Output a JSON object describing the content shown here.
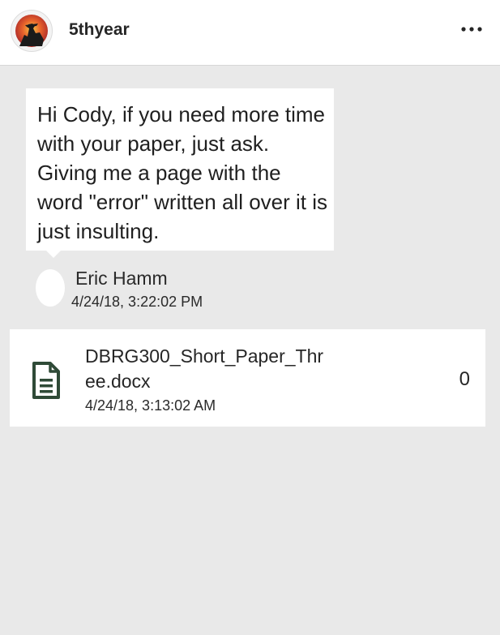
{
  "header": {
    "account_name": "5thyear",
    "avatar_icon": "cowboy-silhouette-sunset-icon",
    "more_icon": "more-dots-icon"
  },
  "message": {
    "text": "Hi Cody, if you need more time with your paper, just ask.  Giving me a page with the word \"error\" written all over it is just insulting.",
    "sender_name": "Eric Hamm",
    "timestamp": "4/24/18, 3:22:02 PM"
  },
  "attachment": {
    "icon": "document-icon",
    "file_name": "DBRG300_Short_Paper_Three.docx",
    "timestamp": "4/24/18, 3:13:02 AM",
    "count": "0"
  },
  "colors": {
    "background": "#e9e9e9",
    "card": "#ffffff",
    "icon_green": "#2f4a37"
  }
}
